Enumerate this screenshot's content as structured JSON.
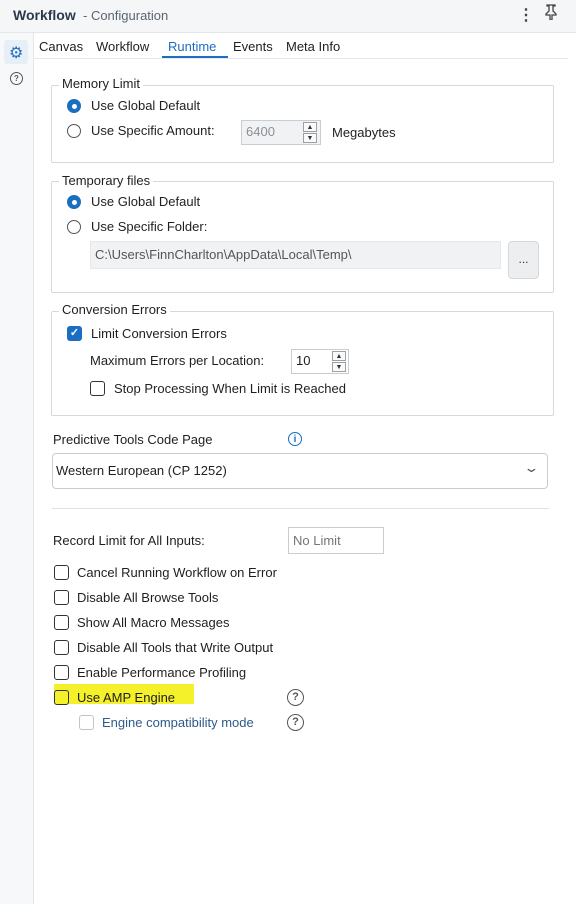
{
  "header": {
    "title_bold": "Workflow",
    "title_rest": "- Configuration",
    "menu_icon": "⋮",
    "pin_icon": "📌"
  },
  "sidebar": {
    "gear_icon": "⚙",
    "help_icon": "?"
  },
  "tabs": [
    {
      "label": "Canvas",
      "active": false
    },
    {
      "label": "Workflow",
      "active": false
    },
    {
      "label": "Runtime",
      "active": true
    },
    {
      "label": "Events",
      "active": false
    },
    {
      "label": "Meta Info",
      "active": false
    }
  ],
  "memory_limit": {
    "legend": "Memory Limit",
    "use_global_default": "Use Global Default",
    "use_specific_amount": "Use Specific Amount:",
    "amount_value": "6400",
    "unit": "Megabytes"
  },
  "temporary_files": {
    "legend": "Temporary files",
    "use_global_default": "Use Global Default",
    "use_specific_folder": "Use Specific Folder:",
    "folder_path": "C:\\Users\\FinnCharlton\\AppData\\Local\\Temp\\",
    "browse_label": "..."
  },
  "conversion_errors": {
    "legend": "Conversion Errors",
    "limit_label": "Limit Conversion Errors",
    "max_label": "Maximum Errors per Location:",
    "max_value": "10",
    "stop_label": "Stop Processing When Limit is Reached"
  },
  "predictive": {
    "label": "Predictive Tools Code Page",
    "info_icon": "i",
    "selected": "Western European (CP 1252)"
  },
  "record_limit": {
    "label": "Record Limit for All Inputs:",
    "placeholder": "No Limit"
  },
  "options": [
    {
      "label": "Cancel Running Workflow on Error"
    },
    {
      "label": "Disable All Browse Tools"
    },
    {
      "label": "Show All Macro Messages"
    },
    {
      "label": "Disable All Tools that Write Output"
    },
    {
      "label": "Enable Performance Profiling"
    },
    {
      "label": "Use AMP Engine"
    }
  ],
  "engine_compat": {
    "label": "Engine compatibility mode",
    "help_icon": "?"
  },
  "amp_help_icon": "?",
  "colors": {
    "accent": "#1b6ec2",
    "highlight": "#f4f12a"
  }
}
